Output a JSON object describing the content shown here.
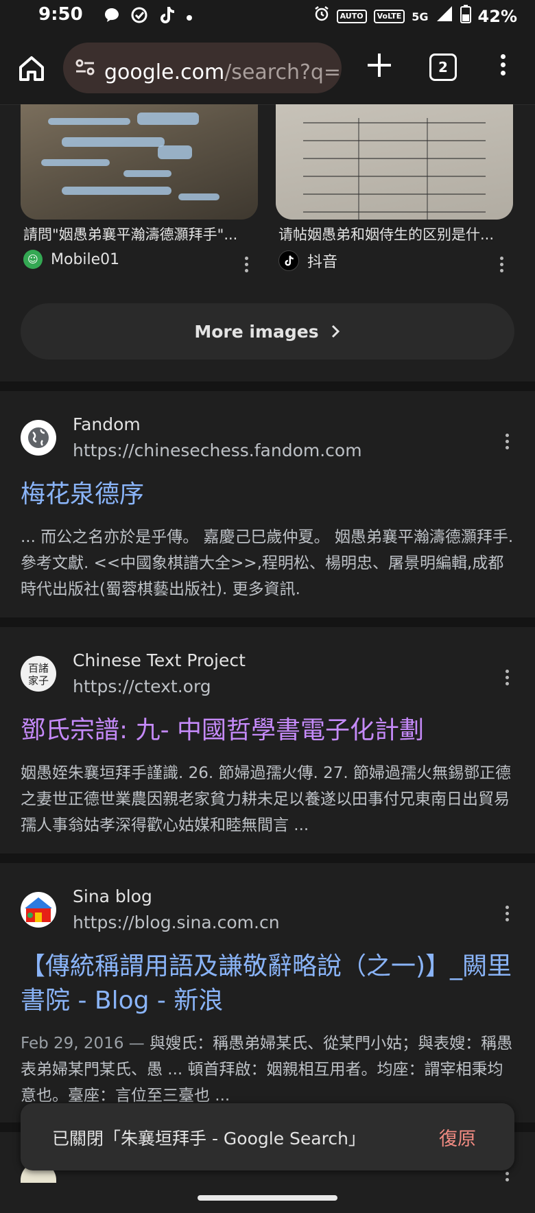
{
  "status_bar": {
    "time": "9:50",
    "battery": "42%",
    "network": "5G",
    "icons": [
      "message-icon",
      "check-circle-icon",
      "tiktok-icon",
      "dot-icon",
      "alarm-icon",
      "auto-hd-icon",
      "volte-icon",
      "signal-icon",
      "battery-icon"
    ],
    "tag_auto": "AUTO",
    "tag_volte": "VoLTE"
  },
  "toolbar": {
    "url_host": "google.com",
    "url_rest": "/search?q=姻",
    "tab_count": "2"
  },
  "image_results": [
    {
      "caption": "請問\"姻愚弟襄平瀚濤德灝拜手\"...",
      "source": "Mobile01",
      "source_icon_color": "#34a853"
    },
    {
      "caption": "请帖姻愚弟和姻侍生的区别是什...",
      "source": "抖音",
      "source_icon_color": "#000000"
    }
  ],
  "more_images": {
    "label": "More images"
  },
  "results": [
    {
      "site": "Fandom",
      "url": "https://chinesechess.fandom.com",
      "title": "梅花泉德序",
      "snippet": "... 而公之名亦於是乎傳。 嘉慶己巳歲仲夏。 姻愚弟襄平瀚濤德灝拜手. 參考文獻. <<中國象棋譜大全>>,程明松、楊明忠、屠景明編輯,成都時代出版社(蜀蓉棋藝出版社). 更多資訊."
    },
    {
      "site": "Chinese Text Project",
      "url": "https://ctext.org",
      "icon_text": "百諸家子",
      "title": "鄧氏宗譜: 九- 中國哲學書電子化計劃",
      "snippet": "姻愚姪朱襄垣拜手謹識. 26. 節婦過孺火傳. 27. 節婦過孺火無錫鄧正德之妻世正德世業農因親老家貧力耕未足以養遂以田事付兄東南日出貿易孺人事翁姑孝深得歡心姑媒和睦無間言 ..."
    },
    {
      "site": "Sina blog",
      "url": "https://blog.sina.com.cn",
      "title": "【傳統稱謂用語及謙敬辭略說（之一)】_闕里書院 - Blog - 新浪",
      "date": "Feb 29, 2016 —",
      "snippet": "與嫂氏：稱愚弟婦某氏、從某門小姑；與表嫂：稱愚表弟婦某門某氏、愚 ... 頓首拜啟：姻親相互用者。均座：謂宰相秉均意也。臺座：言位至三臺也 ..."
    }
  ],
  "toast": {
    "message": "已關閉「朱襄垣拜手 - Google Search」",
    "action": "復原"
  }
}
